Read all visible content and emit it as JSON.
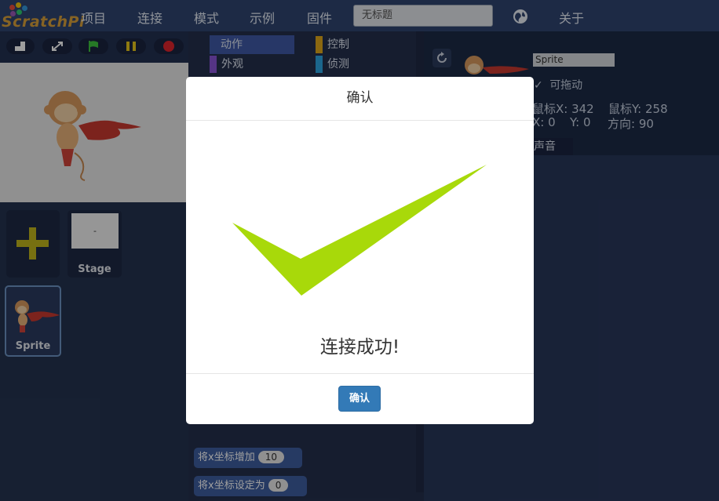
{
  "app": {
    "logo_text": "ScratchPi",
    "title_value": "无标题"
  },
  "menu": {
    "items": [
      "项目",
      "连接",
      "模式",
      "示例",
      "固件",
      "关于"
    ]
  },
  "sprites": {
    "stage_label": "Stage",
    "sprite_label": "Sprite",
    "stage_thumb_text": "-"
  },
  "palette": {
    "categories": [
      {
        "label": "动作",
        "color": "#4a6cd4"
      },
      {
        "label": "控制",
        "color": "#e1a91a"
      },
      {
        "label": "外观",
        "color": "#8a55d7"
      },
      {
        "label": "侦测",
        "color": "#2ca5e2"
      }
    ],
    "blocks": [
      {
        "label": "将x坐标增加",
        "value": "10"
      },
      {
        "label": "将x坐标设定为",
        "value": "0"
      }
    ]
  },
  "info": {
    "sprite_name": "Sprite",
    "draggable_label": "可拖动",
    "mouse_x": "鼠标X: 342",
    "mouse_y": "鼠标Y: 258",
    "x": "X: 0",
    "y": "Y: 0",
    "direction": "方向: 90",
    "sound_tab": "声音"
  },
  "dialog": {
    "title": "确认",
    "message": "连接成功!",
    "ok_label": "确认",
    "check_color": "#a8d90a"
  },
  "colors": {
    "topbar": "#2f4470",
    "accent_button": "#337ab7"
  }
}
